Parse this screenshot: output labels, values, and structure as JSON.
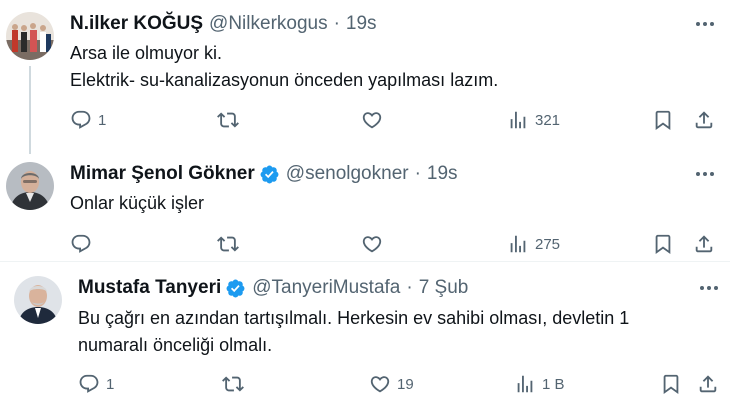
{
  "tweets": [
    {
      "name": "N.ilker KOĞUŞ",
      "handle": "@Nilkerkogus",
      "time": "19s",
      "verified": false,
      "lines": [
        "Arsa ile olmuyor ki.",
        "Elektrik- su-kanalizasyonun önceden yapılması lazım."
      ],
      "replies": "1",
      "retweets": "",
      "likes": "",
      "views": "321"
    },
    {
      "name": "Mimar Şenol Gökner",
      "handle": "@senolgokner",
      "time": "19s",
      "verified": true,
      "lines": [
        "Onlar küçük işler"
      ],
      "replies": "",
      "retweets": "",
      "likes": "",
      "views": "275"
    },
    {
      "name": "Mustafa Tanyeri",
      "handle": "@TanyeriMustafa",
      "time": "7 Şub",
      "verified": true,
      "lines": [
        "Bu çağrı en azından tartışılmalı. Herkesin ev sahibi olması, devletin 1",
        "numaralı önceliği olmalı."
      ],
      "replies": "1",
      "retweets": "",
      "likes": "19",
      "views": "1 B"
    }
  ],
  "colors": {
    "text": "#0f1419",
    "secondary": "#536471",
    "verified": "#1d9bf0",
    "divider": "#eff3f4",
    "thread": "#cfd9de"
  },
  "icons": [
    "reply-icon",
    "retweet-icon",
    "like-icon",
    "views-icon",
    "bookmark-icon",
    "share-icon",
    "more-icon",
    "verified-badge-icon"
  ]
}
